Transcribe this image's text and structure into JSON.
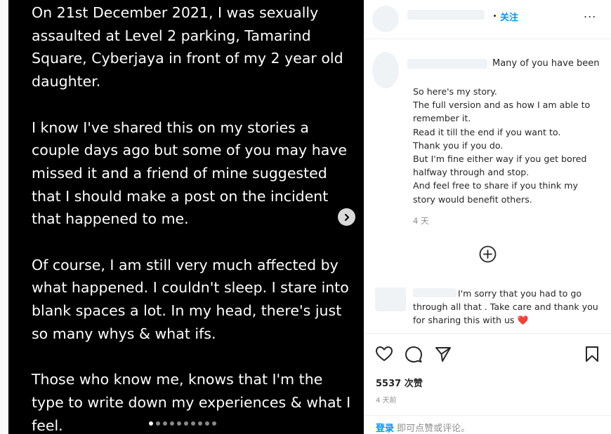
{
  "post": {
    "paragraphs": [
      "On 21st December 2021, I was sexually assaulted at Level 2 parking, Tamarind Square, Cyberjaya in front of my 2 year old daughter.",
      "I know I've shared this on my stories a couple days ago but some of you may have missed it and a friend of mine suggested that I should make a post on the incident that happened to me.",
      "Of course, I am still very much affected by what happened. I couldn't sleep. I stare into blank spaces a lot. In my head, there's just so many whys & what ifs.",
      "Those who know me, knows that I'm the type to write down my experiences & what I feel."
    ],
    "slide_count": 10,
    "active_slide": 0,
    "next_icon": "chevron-right-icon"
  },
  "header": {
    "follow_label": "关注",
    "more_label": "..."
  },
  "caption": {
    "head": "Many of you have been",
    "lines": [
      "So here's my story.",
      "The full version and as how I am able to remember it.",
      "Read it till the end if you want to.",
      "Thank you if you do.",
      "But I'm fine either way if you get bored halfway through and stop.",
      "And feel free to share if you think my story would benefit others."
    ],
    "time": "4 天"
  },
  "comment": {
    "first": "I'm sorry that you had to go",
    "rest": "through all that . Take care and thank you for sharing this with us",
    "emoji": "❤️"
  },
  "actions": {
    "icons": [
      "heart-icon",
      "comment-icon",
      "share-icon",
      "bookmark-icon"
    ],
    "likes": "5537 次赞",
    "time": "4 天前"
  },
  "footer": {
    "login_link": "登录",
    "login_text": " 即可点赞或评论。"
  },
  "colors": {
    "accent": "#0095f6",
    "heart": "#e0245e"
  }
}
